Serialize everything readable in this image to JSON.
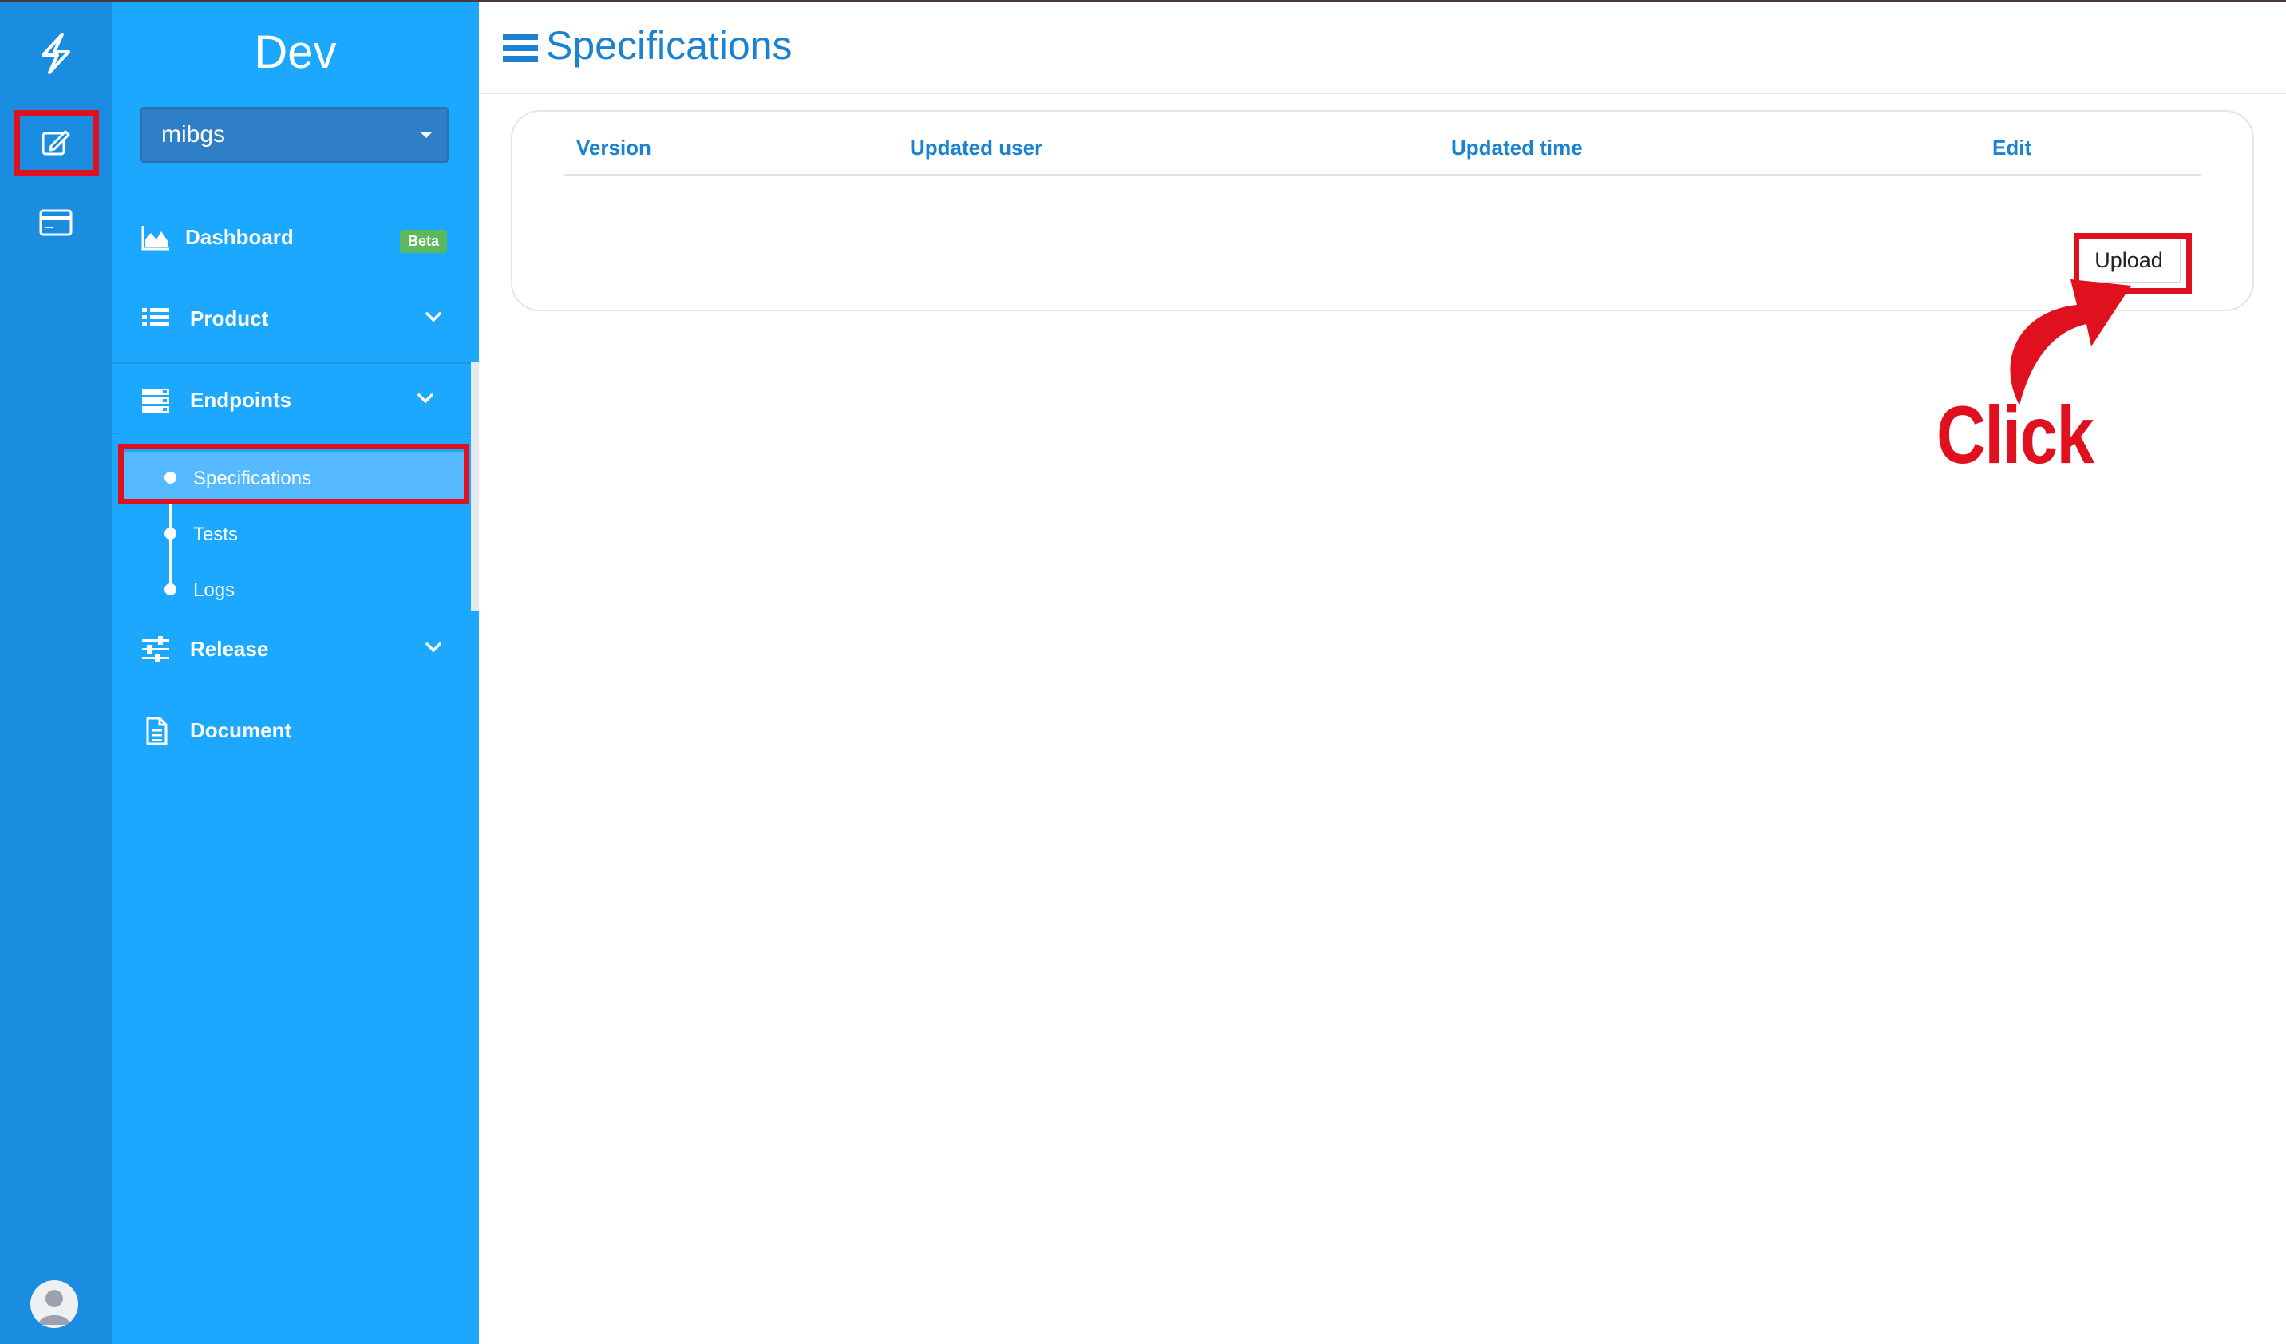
{
  "sidebar": {
    "brand": "Dev",
    "project_selector": {
      "value": "mibgs"
    },
    "items": [
      {
        "label": "Dashboard",
        "badge": "Beta",
        "icon": "area-chart-icon"
      },
      {
        "label": "Product",
        "icon": "list-icon"
      },
      {
        "label": "Endpoints",
        "icon": "server-icon",
        "expanded": true,
        "children": [
          {
            "label": "Specifications",
            "active": true
          },
          {
            "label": "Tests"
          },
          {
            "label": "Logs"
          }
        ]
      },
      {
        "label": "Release",
        "icon": "sliders-icon"
      },
      {
        "label": "Document",
        "icon": "document-icon"
      }
    ]
  },
  "rail": {
    "icons": [
      "bolt-icon",
      "edit-icon",
      "credit-card-icon",
      "avatar"
    ]
  },
  "main": {
    "title": "Specifications",
    "table": {
      "columns": [
        "Version",
        "Updated user",
        "Updated time",
        "Edit"
      ],
      "rows": []
    },
    "upload_label": "Upload"
  },
  "annotation": {
    "callout_text": "Click",
    "highlight_color": "#e0101e"
  },
  "colors": {
    "rail": "#1a8de0",
    "nav": "#1da8ff",
    "accent": "#1b82d1",
    "badge": "#5cb85c"
  }
}
